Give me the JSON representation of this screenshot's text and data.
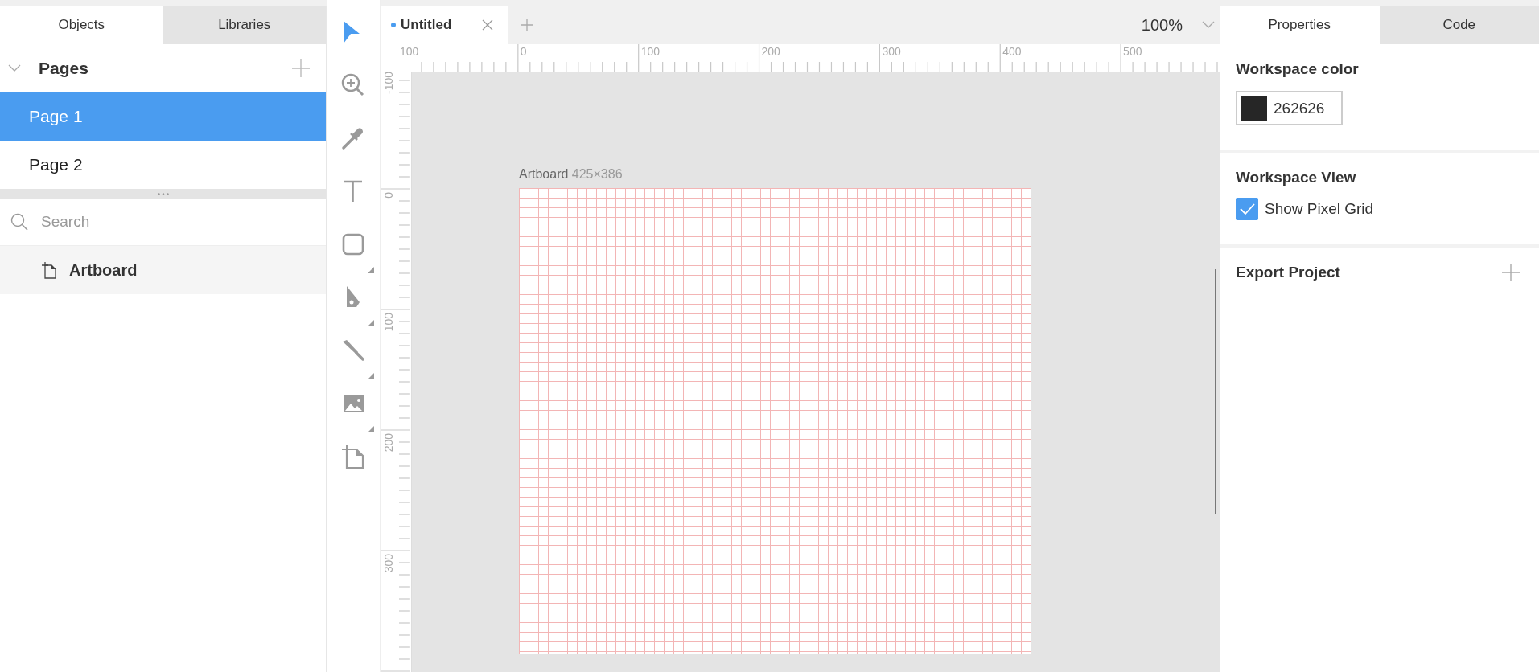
{
  "left_panel": {
    "tabs": [
      {
        "label": "Objects",
        "selected": true
      },
      {
        "label": "Libraries",
        "selected": false
      }
    ],
    "pages": {
      "title": "Pages",
      "expanded": true,
      "items": [
        {
          "label": "Page 1",
          "selected": true
        },
        {
          "label": "Page 2",
          "selected": false
        }
      ]
    },
    "search": {
      "placeholder": "Search"
    },
    "layers": [
      {
        "label": "Artboard",
        "kind": "artboard"
      }
    ]
  },
  "tools": [
    {
      "kind": "select",
      "selected": true,
      "has_menu": false
    },
    {
      "kind": "zoom",
      "selected": false,
      "has_menu": false
    },
    {
      "kind": "eyedropper",
      "selected": false,
      "has_menu": false
    },
    {
      "kind": "text",
      "selected": false,
      "has_menu": false
    },
    {
      "kind": "rectangle",
      "selected": false,
      "has_menu": true
    },
    {
      "kind": "pen",
      "selected": false,
      "has_menu": true
    },
    {
      "kind": "knife",
      "selected": false,
      "has_menu": true
    },
    {
      "kind": "image",
      "selected": false,
      "has_menu": true
    },
    {
      "kind": "artboard",
      "selected": false,
      "has_menu": false
    }
  ],
  "document_tabs": [
    {
      "label": "Untitled",
      "modified": true,
      "selected": true
    }
  ],
  "zoom": "100%",
  "rulers": {
    "horizontal": [
      "100",
      "0",
      "100",
      "200",
      "300",
      "400",
      "500"
    ],
    "vertical": [
      "-100",
      "0",
      "100",
      "200",
      "300"
    ]
  },
  "artboard": {
    "name": "Artboard",
    "size": "425×386"
  },
  "right_panel": {
    "tabs": [
      {
        "label": "Properties",
        "selected": true
      },
      {
        "label": "Code",
        "selected": false
      }
    ],
    "workspace_color": {
      "title": "Workspace color",
      "value": "262626"
    },
    "workspace_view": {
      "title": "Workspace View",
      "options": [
        {
          "label": "Show Pixel Grid",
          "checked": true
        }
      ]
    },
    "export": {
      "title": "Export Project"
    }
  }
}
